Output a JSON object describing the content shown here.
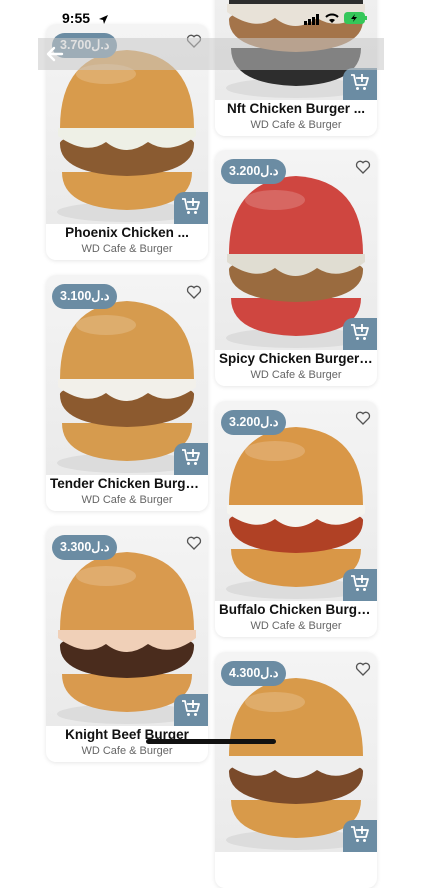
{
  "status_bar": {
    "time": "9:55"
  },
  "products": [
    {
      "id": "p1",
      "price": "3.700د.ل",
      "name": "Phoenix Chicken ...",
      "vendor": "WD Cafe & Burger",
      "bun": "#d89b4c",
      "filling": "#8a5b31",
      "sauce": "#eef0e6"
    },
    {
      "id": "p2",
      "price": "",
      "name": "Nft Chicken Burger ...",
      "vendor": "WD Cafe & Burger",
      "bun": "#2d2d2d",
      "filling": "#a4744a",
      "sauce": "#e8e2d8"
    },
    {
      "id": "p3",
      "price": "3.200د.ل",
      "name": "Spicy Chicken Burger ...",
      "vendor": "WD Cafe & Burger",
      "bun": "#cf4640",
      "filling": "#9a6b3f",
      "sauce": "#e0ddd2"
    },
    {
      "id": "p4",
      "price": "3.100د.ل",
      "name": "Tender Chicken Burge...",
      "vendor": "WD Cafe & Burger",
      "bun": "#d69b4e",
      "filling": "#8c5a2f",
      "sauce": "#f2f0ea"
    },
    {
      "id": "p5",
      "price": "3.200د.ل",
      "name": "Buffalo Chicken Burge...",
      "vendor": "WD Cafe & Burger",
      "bun": "#d99747",
      "filling": "#b04125",
      "sauce": "#f5f4ef"
    },
    {
      "id": "p6",
      "price": "3.300د.ل",
      "name": "Knight Beef Burger",
      "vendor": "WD Cafe & Burger",
      "bun": "#d99a4e",
      "filling": "#4a2c1d",
      "sauce": "#f0d0b8"
    },
    {
      "id": "p7",
      "price": "4.300د.ل",
      "name": "",
      "vendor": "",
      "bun": "#d89a4a",
      "filling": "#7a4a2a",
      "sauce": "#eee"
    }
  ],
  "colors": {
    "accent": "#6b8ca3"
  }
}
